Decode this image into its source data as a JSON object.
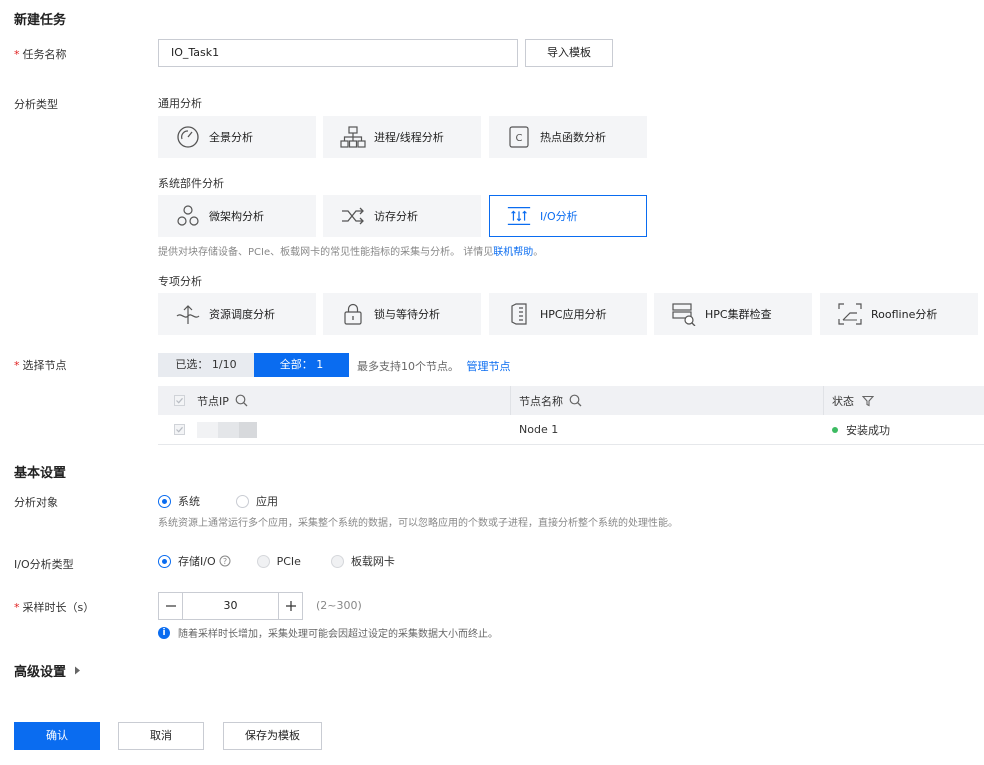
{
  "page": {
    "title": "新建任务"
  },
  "task_name": {
    "label": "任务名称",
    "value": "IO_Task1",
    "import_button": "导入模板"
  },
  "analysis_type": {
    "label": "分析类型",
    "general": {
      "label": "通用分析",
      "items": [
        {
          "label": "全景分析",
          "icon": "gauge-icon"
        },
        {
          "label": "进程/线程分析",
          "icon": "hierarchy-icon"
        },
        {
          "label": "热点函数分析",
          "icon": "function-c-icon"
        }
      ]
    },
    "system": {
      "label": "系统部件分析",
      "items": [
        {
          "label": "微架构分析",
          "icon": "microarch-icon"
        },
        {
          "label": "访存分析",
          "icon": "shuffle-icon"
        },
        {
          "label": "I/O分析",
          "icon": "io-icon",
          "selected": true
        }
      ],
      "hint": "提供对块存储设备、PCIe、板载网卡的常见性能指标的采集与分析。 详情见",
      "hint_link": "联机帮助",
      "hint_end": "。"
    },
    "special": {
      "label": "专项分析",
      "items": [
        {
          "label": "资源调度分析",
          "icon": "schedule-icon"
        },
        {
          "label": "锁与等待分析",
          "icon": "lock-icon"
        },
        {
          "label": "HPC应用分析",
          "icon": "hpc-app-icon"
        },
        {
          "label": "HPC集群检查",
          "icon": "hpc-cluster-icon"
        },
        {
          "label": "Roofline分析",
          "icon": "roofline-icon"
        }
      ]
    }
  },
  "nodes": {
    "label": "选择节点",
    "selected_tab": "已选：  1/10",
    "all_tab": "全部：  1",
    "hint": "最多支持10个节点。",
    "manage_link": "管理节点",
    "columns": [
      "节点IP",
      "节点名称",
      "状态"
    ],
    "rows": [
      {
        "ip": "",
        "name": "Node 1",
        "status": "安装成功"
      }
    ],
    "status_color": "#3dbb62"
  },
  "basic": {
    "title": "基本设置",
    "target": {
      "label": "分析对象",
      "options": [
        "系统",
        "应用"
      ],
      "hint": "系统资源上通常运行多个应用，采集整个系统的数据，可以忽略应用的个数或子进程，直接分析整个系统的处理性能。"
    },
    "io_type": {
      "label": "I/O分析类型",
      "options": [
        "存储I/O",
        "PCIe",
        "板载网卡"
      ]
    },
    "duration": {
      "label": "采样时长（s）",
      "value": "30",
      "range": "(2~300)",
      "hint": "随着采样时长增加，采集处理可能会因超过设定的采集数据大小而终止。"
    }
  },
  "advanced": {
    "title": "高级设置"
  },
  "footer": {
    "confirm": "确认",
    "cancel": "取消",
    "save_template": "保存为模板"
  },
  "colors": {
    "primary": "#0a6cf0",
    "required": "#e02020",
    "card_bg": "#f4f5f7"
  }
}
